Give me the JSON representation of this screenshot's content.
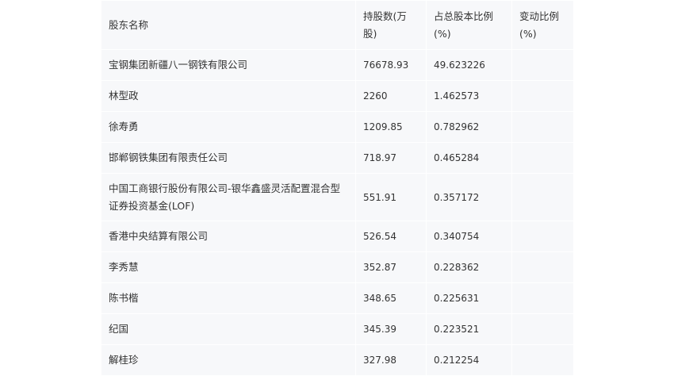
{
  "table": {
    "headers": [
      "股东名称",
      "持股数(万股)",
      "占总股本比例(%)",
      "变动比例(%)"
    ],
    "rows": [
      {
        "name": "宝钢集团新疆八一钢铁有限公司",
        "shares": "76678.93",
        "ratio": "49.623226",
        "change": ""
      },
      {
        "name": "林型政",
        "shares": "2260",
        "ratio": "1.462573",
        "change": ""
      },
      {
        "name": "徐寿勇",
        "shares": "1209.85",
        "ratio": "0.782962",
        "change": ""
      },
      {
        "name": "邯郸钢铁集团有限责任公司",
        "shares": "718.97",
        "ratio": "0.465284",
        "change": ""
      },
      {
        "name": "中国工商银行股份有限公司-银华鑫盛灵活配置混合型证券投资基金(LOF)",
        "shares": "551.91",
        "ratio": "0.357172",
        "change": ""
      },
      {
        "name": "香港中央结算有限公司",
        "shares": "526.54",
        "ratio": "0.340754",
        "change": ""
      },
      {
        "name": "李秀慧",
        "shares": "352.87",
        "ratio": "0.228362",
        "change": ""
      },
      {
        "name": "陈书楷",
        "shares": "348.65",
        "ratio": "0.225631",
        "change": ""
      },
      {
        "name": "纪国",
        "shares": "345.39",
        "ratio": "0.223521",
        "change": ""
      },
      {
        "name": "解桂珍",
        "shares": "327.98",
        "ratio": "0.212254",
        "change": ""
      }
    ]
  }
}
